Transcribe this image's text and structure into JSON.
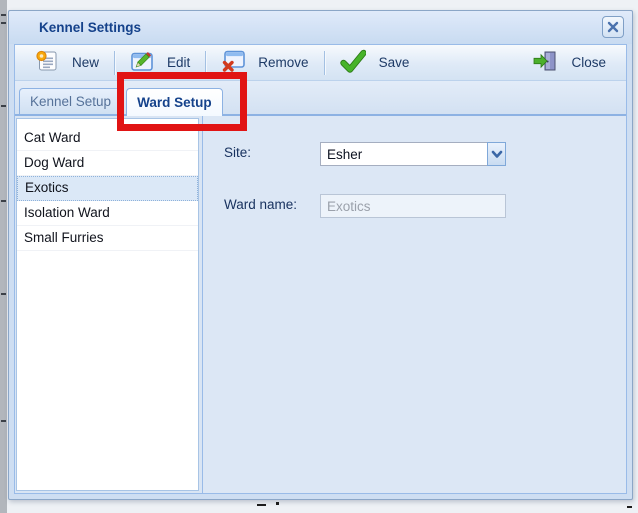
{
  "window": {
    "title": "Kennel Settings"
  },
  "toolbar": {
    "new_label": "New",
    "edit_label": "Edit",
    "remove_label": "Remove",
    "save_label": "Save",
    "close_label": "Close"
  },
  "tabs": {
    "kennel_setup": "Kennel Setup",
    "ward_setup": "Ward Setup",
    "active_tab": "Ward Setup"
  },
  "ward_list": {
    "items": [
      "Cat Ward",
      "Dog Ward",
      "Exotics",
      "Isolation Ward",
      "Small Furries"
    ],
    "selected": "Exotics"
  },
  "form": {
    "site_label": "Site:",
    "site_value": "Esher",
    "ward_name_label": "Ward name:",
    "ward_name_value": "Exotics"
  },
  "colors": {
    "annotation_red": "#e11414",
    "title_text": "#15428b",
    "panel_blue": "#dce7f5",
    "selected_row": "#dbe8f7"
  }
}
